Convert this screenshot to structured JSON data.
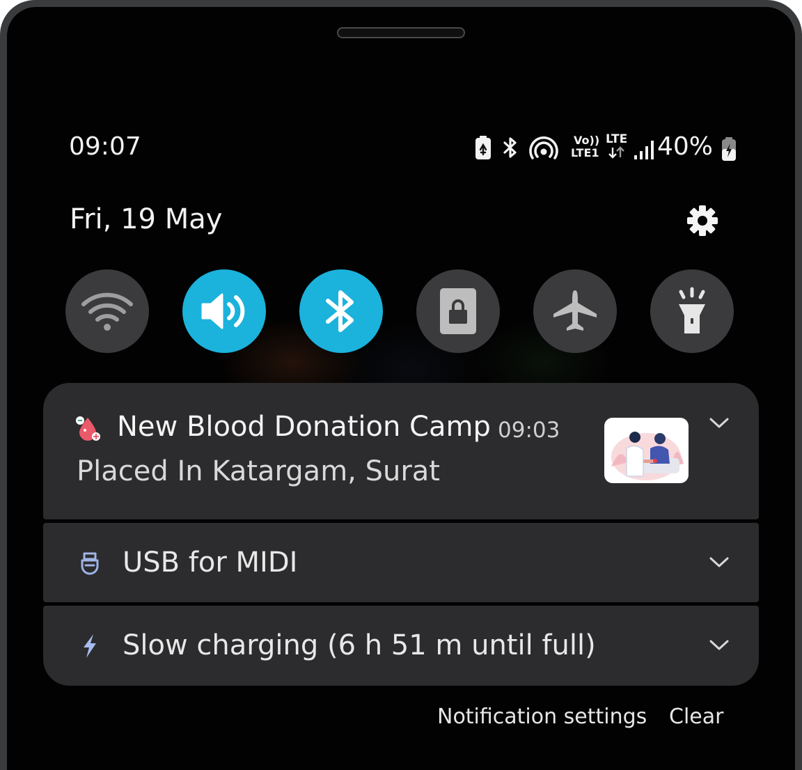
{
  "status_bar": {
    "time": "09:07",
    "volte_label_top": "Vo))",
    "volte_label_bottom": "LTE1",
    "network_type": "LTE",
    "battery_percent": "40%"
  },
  "date_row": {
    "date": "Fri, 19 May"
  },
  "quick_settings": [
    {
      "name": "wifi",
      "icon": "wifi-icon",
      "active": false
    },
    {
      "name": "sound",
      "icon": "speaker-icon",
      "active": true
    },
    {
      "name": "bluetooth",
      "icon": "bluetooth-icon",
      "active": true
    },
    {
      "name": "portrait-lock",
      "icon": "lock-icon",
      "active": false
    },
    {
      "name": "airplane-mode",
      "icon": "airplane-icon",
      "active": false
    },
    {
      "name": "flashlight",
      "icon": "flashlight-icon",
      "active": false
    }
  ],
  "notifications": [
    {
      "title": "New Blood Donation Camp",
      "time": "09:03",
      "text": "Placed In Katargam, Surat",
      "icon": "blood-drop-icon"
    },
    {
      "title": "USB for MIDI",
      "icon": "usb-icon"
    },
    {
      "title": "Slow charging (6 h 51 m until full)",
      "icon": "lightning-icon"
    }
  ],
  "footer": {
    "settings_label": "Notification settings",
    "clear_label": "Clear"
  },
  "colors": {
    "accent": "#1bb2dc",
    "tile_off": "#3b3b3d",
    "card": "#2c2c2e",
    "background": "#020202"
  }
}
